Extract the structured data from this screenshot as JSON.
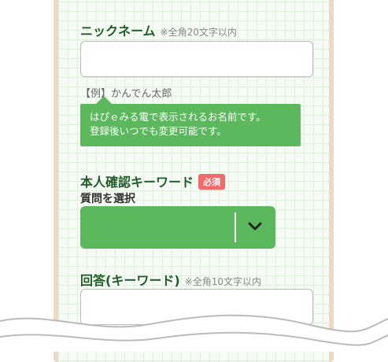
{
  "nickname": {
    "title": "ニックネーム",
    "hint": "※全角20文字以内",
    "value": "",
    "example": "【例】かんでん太郎",
    "tooltip_line1": "はぴｅみる電で表示されるお名前です。",
    "tooltip_line2": "登録後いつでも変更可能です。"
  },
  "keyword_section": {
    "title": "本人確認キーワード",
    "required_badge": "必須",
    "question_label": "質問を選択",
    "question_selected": ""
  },
  "answer": {
    "title": "回答(キーワード)",
    "hint": "※全角10文字以内",
    "value": ""
  },
  "colors": {
    "accent_green": "#5cb85c",
    "heading_green": "#1f5c28",
    "required_red": "#f26a6a"
  },
  "icons": {
    "select_arrow": "chevron-down-icon"
  }
}
